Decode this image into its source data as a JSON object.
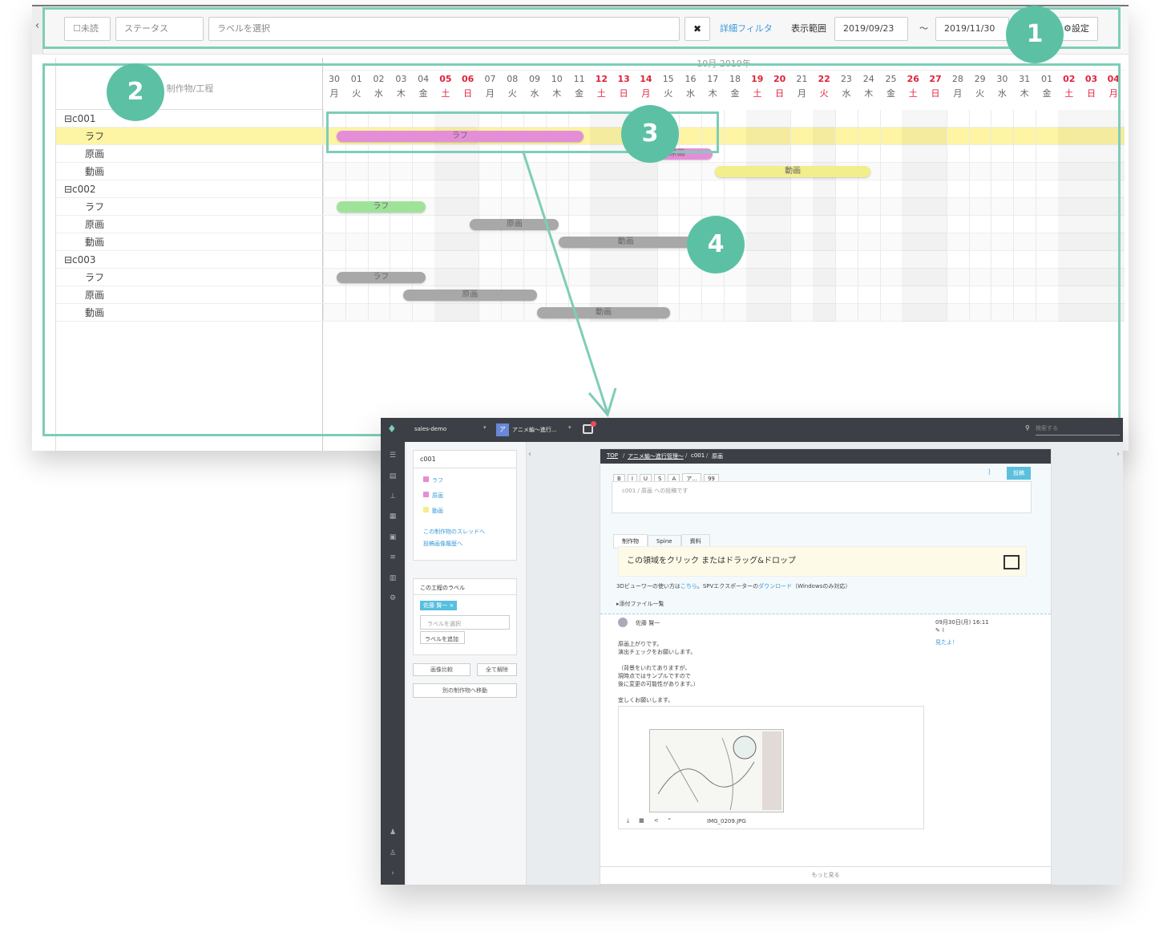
{
  "toolbar": {
    "unread": "未読",
    "status": "ステータス",
    "label_placeholder": "ラベルを選択",
    "clear": "✖",
    "detail_filter": "詳細フィルタ",
    "range_label": "表示範囲",
    "start_date": "2019/09/23",
    "tilde": "〜",
    "end_date": "2019/11/30",
    "settings": "設定"
  },
  "gantt": {
    "column_header": "制作物/工程",
    "month_label": "10月 2019年",
    "days": [
      "30",
      "01",
      "02",
      "03",
      "04",
      "05",
      "06",
      "07",
      "08",
      "09",
      "10",
      "11",
      "12",
      "13",
      "14",
      "15",
      "16",
      "17",
      "18",
      "19",
      "20",
      "21",
      "22",
      "23",
      "24",
      "25",
      "26",
      "27",
      "28",
      "29",
      "30",
      "31",
      "01",
      "02",
      "03",
      "04"
    ],
    "weekdays": [
      "月",
      "火",
      "水",
      "木",
      "金",
      "土",
      "日",
      "月",
      "火",
      "水",
      "木",
      "金",
      "土",
      "日",
      "月",
      "火",
      "水",
      "木",
      "金",
      "土",
      "日",
      "月",
      "火",
      "水",
      "木",
      "金",
      "土",
      "日",
      "月",
      "火",
      "水",
      "木",
      "金",
      "土",
      "日",
      "月"
    ],
    "red_days": [
      5,
      6,
      12,
      13,
      14,
      19,
      20,
      22,
      26,
      27,
      33,
      34,
      35
    ],
    "rows": [
      {
        "label": "c001",
        "group": true
      },
      {
        "label": "ラフ",
        "selected": true
      },
      {
        "label": "原画"
      },
      {
        "label": "動画"
      },
      {
        "label": "c002",
        "group": true
      },
      {
        "label": "ラフ"
      },
      {
        "label": "原画"
      },
      {
        "label": "動画"
      },
      {
        "label": "c003",
        "group": true
      },
      {
        "label": "ラフ"
      },
      {
        "label": "原画"
      },
      {
        "label": "動画"
      }
    ],
    "bars": [
      {
        "row": 1,
        "start": 0.6,
        "end": 11.7,
        "label": "ラフ",
        "color": "#e58ed8"
      },
      {
        "row": 2,
        "start": 14.3,
        "end": 17.5,
        "label": "原画",
        "color": "#e58ed8"
      },
      {
        "row": 3,
        "start": 17.6,
        "end": 24.6,
        "label": "動画",
        "color": "#f3ee8c"
      },
      {
        "row": 5,
        "start": 0.6,
        "end": 4.6,
        "label": "ラフ",
        "color": "#9fe39a"
      },
      {
        "row": 6,
        "start": 6.6,
        "end": 10.6,
        "label": "原画",
        "color": "#a8a8a8"
      },
      {
        "row": 7,
        "start": 10.6,
        "end": 16.6,
        "label": "動画",
        "color": "#a8a8a8"
      },
      {
        "row": 9,
        "start": 0.6,
        "end": 4.6,
        "label": "ラフ",
        "color": "#a8a8a8"
      },
      {
        "row": 10,
        "start": 3.6,
        "end": 9.6,
        "label": "原画",
        "color": "#a8a8a8"
      },
      {
        "row": 11,
        "start": 9.6,
        "end": 15.6,
        "label": "動画",
        "color": "#a8a8a8"
      }
    ]
  },
  "badges": [
    "1",
    "2",
    "3",
    "4"
  ],
  "detail": {
    "project": "sales-demo",
    "work_icon": "ア",
    "work_name": "アニメ編〜進行...",
    "search_placeholder": "検索する",
    "breadcrumb": [
      "TOP",
      "アニメ編〜進行管理〜",
      "c001",
      "原画"
    ],
    "left": {
      "title": "c001",
      "processes": [
        "ラフ",
        "原画",
        "動画"
      ],
      "process_colors": [
        "#e58ed8",
        "#e58ed8",
        "#f3ee8c"
      ],
      "thread_link": "この制作物のスレッドへ",
      "history_link": "投稿画像履歴へ",
      "label_section": "この工程のラベル",
      "label_tag": "佐藤 賢一 ×",
      "label_select": "ラベルを選択",
      "label_add": "ラベルを追加",
      "compare": "画像比較",
      "clear_all": "全て解除",
      "move": "別の制作物へ移動"
    },
    "editor": {
      "placeholder": "c001 / 原画 への投稿です",
      "post": "投稿",
      "tools": [
        "B",
        "I",
        "U",
        "S",
        "A",
        "ア...",
        "99"
      ],
      "tabs": [
        "制作物",
        "Spine",
        "資料"
      ],
      "dropzone": "この領域をクリック またはドラッグ&ドロップ",
      "viewer_text": "3Dビューワーの使い方は",
      "here": "こちら",
      "exporter_text": "。SPVエクスポーターの",
      "download": "ダウンロード",
      "windows_only": "（Windowsのみ対応）",
      "attachments": "添付ファイル一覧"
    },
    "post": {
      "author": "佐藤 賢一",
      "date": "09月30日(月) 16:11",
      "seen": "見たよ！",
      "lines": [
        "原画上がりです。",
        "演出チェックをお願いします。",
        "",
        "（背景をいれてありますが、",
        "現時点ではサンプルですので",
        "後に変更の可能性があります。）",
        "",
        "宜しくお願いします。"
      ],
      "file_name": "IMG_0209.JPG"
    },
    "more": "もっと見る"
  }
}
